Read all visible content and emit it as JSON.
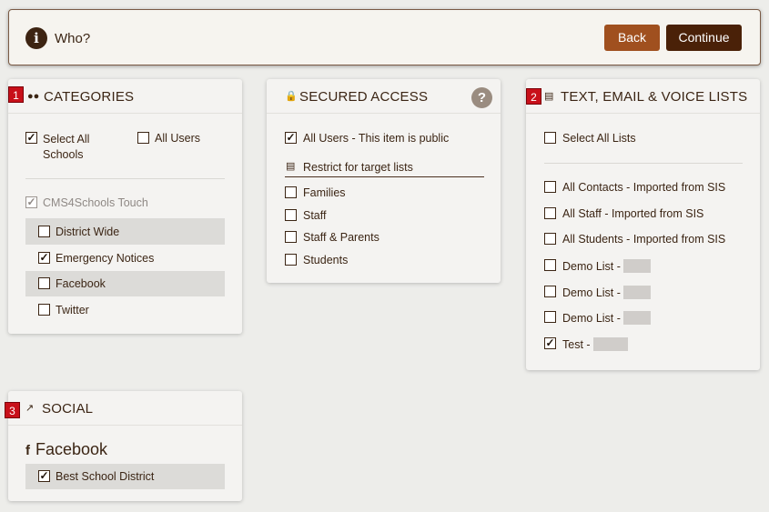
{
  "header": {
    "title": "Who?",
    "back_label": "Back",
    "continue_label": "Continue"
  },
  "categories": {
    "badge": "1",
    "title": "CATEGORIES",
    "select_all_line1": "Select All",
    "select_all_line2": "Schools",
    "all_users": "All Users",
    "group_title": "CMS4Schools Touch",
    "items": [
      "District Wide",
      "Emergency Notices",
      "Facebook",
      "Twitter"
    ]
  },
  "secured_access": {
    "title": "SECURED ACCESS",
    "all_users": "All Users - This item is public",
    "restrict_label": "Restrict for target lists",
    "items": [
      "Families",
      "Staff",
      "Staff & Parents",
      "Students"
    ]
  },
  "lists": {
    "badge": "2",
    "title": "TEXT, EMAIL & VOICE LISTS",
    "select_all": "Select All Lists",
    "items": [
      "All Contacts - Imported from SIS",
      "All Staff - Imported from SIS",
      "All Students - Imported from SIS",
      "Demo List -",
      "Demo List -",
      "Demo List -",
      "Test -"
    ]
  },
  "social": {
    "badge": "3",
    "title": "SOCIAL",
    "network": "Facebook",
    "account": "Best School District"
  }
}
